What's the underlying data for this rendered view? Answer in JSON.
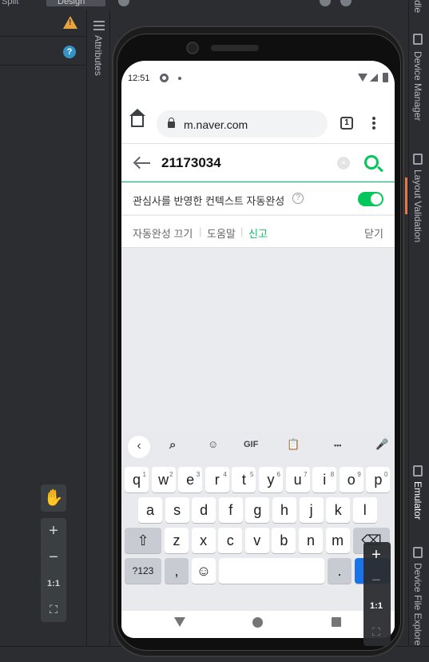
{
  "ide": {
    "top_split_label": "Split",
    "top_design_label": "Design",
    "attributes_label": "Attributes",
    "warning_glyph": "!",
    "help_glyph": "?",
    "right_tabs": [
      {
        "label": "Device Manager",
        "active": false
      },
      {
        "label": "Layout Validation",
        "active": false
      },
      {
        "label": "Emulator",
        "active": true
      },
      {
        "label": "Device File Explorer",
        "active": false
      }
    ],
    "right_top_fragment": "dle",
    "zoom_left": {
      "plus": "+",
      "minus": "−",
      "one_to_one": "1:1"
    },
    "zoom_right": {
      "plus": "+",
      "minus": "−",
      "one_to_one": "1:1"
    }
  },
  "phone": {
    "status": {
      "time": "12:51"
    },
    "browser": {
      "url": "m.naver.com",
      "tab_count": "1"
    },
    "search": {
      "query": "21173034",
      "clear_glyph": "×"
    },
    "autocomplete": {
      "label": "관심사를 반영한 컨텍스트 자동완성",
      "info_glyph": "?",
      "enabled": true
    },
    "links": {
      "turn_off": "자동완성 끄기",
      "help": "도움말",
      "report": "신고",
      "close": "닫기",
      "separator": "|"
    },
    "keyboard": {
      "toolbar": {
        "back": "‹",
        "gif": "GIF",
        "more": "•••"
      },
      "row1": [
        {
          "k": "q",
          "h": "1"
        },
        {
          "k": "w",
          "h": "2"
        },
        {
          "k": "e",
          "h": "3"
        },
        {
          "k": "r",
          "h": "4"
        },
        {
          "k": "t",
          "h": "5"
        },
        {
          "k": "y",
          "h": "6"
        },
        {
          "k": "u",
          "h": "7"
        },
        {
          "k": "i",
          "h": "8"
        },
        {
          "k": "o",
          "h": "9"
        },
        {
          "k": "p",
          "h": "0"
        }
      ],
      "row2": [
        "a",
        "s",
        "d",
        "f",
        "g",
        "h",
        "j",
        "k",
        "l"
      ],
      "row3": [
        "z",
        "x",
        "c",
        "v",
        "b",
        "n",
        "m"
      ],
      "symbols_key": "?123",
      "comma_key": ",",
      "period_key": "."
    }
  },
  "colors": {
    "naver_green": "#03c75a",
    "ide_bg": "#2b2d30",
    "warning": "#e8a33d",
    "help": "#3592c4"
  }
}
